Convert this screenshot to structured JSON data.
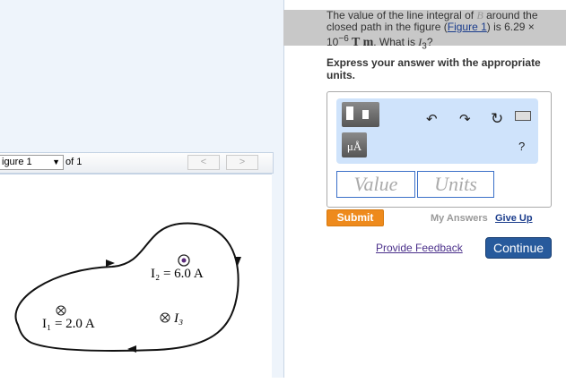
{
  "question": {
    "text1": "The value of the line integral of ",
    "vec": "B",
    "text2": " around the closed path in the figure (",
    "link": "Figure 1",
    "text3": ") is 6.29 × 10",
    "exp": "−6",
    "units": " T m",
    "text4": ". What is ",
    "var": "I",
    "sub": "3",
    "end": "?"
  },
  "instruction": "Express your answer with the appropriate units.",
  "answer": {
    "value_placeholder": "Value",
    "units_placeholder": "Units",
    "units_button": "μÅ",
    "help": "?"
  },
  "actions": {
    "submit": "Submit",
    "my_answers": "My Answers",
    "give_up": "Give Up",
    "feedback": "Provide Feedback",
    "continue": "Continue"
  },
  "figure_nav": {
    "select": "igure 1",
    "of": "of 1",
    "prev": "<",
    "next": ">"
  },
  "figure": {
    "i1": "I₁ = 2.0 A",
    "i2": "I₂ = 6.0 A",
    "i3": "I₃"
  }
}
